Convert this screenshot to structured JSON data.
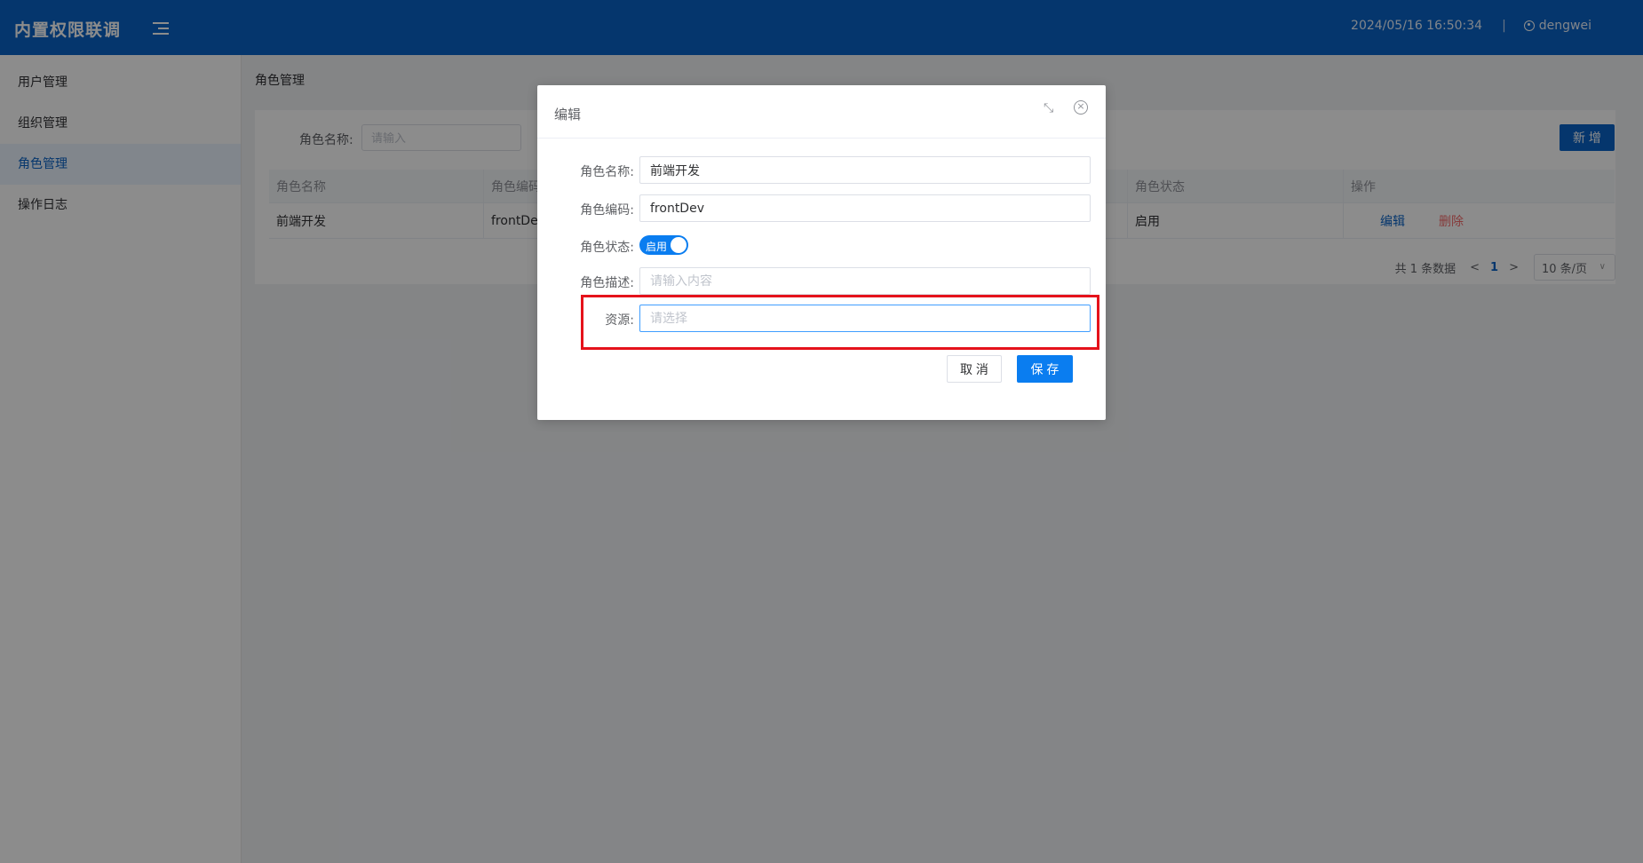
{
  "header": {
    "title": "内置权限联调",
    "datetime": "2024/05/16  16:50:34",
    "separator": "|",
    "username": "dengwei"
  },
  "sidebar": {
    "items": [
      {
        "label": "用户管理"
      },
      {
        "label": "组织管理"
      },
      {
        "label": "角色管理"
      },
      {
        "label": "操作日志"
      }
    ],
    "active_index": 2
  },
  "breadcrumb": "角色管理",
  "search": {
    "label": "角色名称:",
    "placeholder": "请输入"
  },
  "toolbar": {
    "add_label": "新 增"
  },
  "table": {
    "headers": [
      "角色名称",
      "角色编码",
      "",
      "",
      "角色状态",
      "操作"
    ],
    "rows": [
      {
        "name": "前端开发",
        "code": "frontDev",
        "status": "启用",
        "edit": "编辑",
        "delete": "删除"
      }
    ]
  },
  "pager": {
    "total_text": "共 1 条数据",
    "prev": "<",
    "page": "1",
    "next": ">",
    "size_text": "10 条/页",
    "size_chevron": "∨"
  },
  "dialog": {
    "title": "编辑",
    "fullscreen_icon": "⤡",
    "close_icon": "×",
    "fields": {
      "name_label": "角色名称:",
      "name_value": "前端开发",
      "code_label": "角色编码:",
      "code_value": "frontDev",
      "status_label": "角色状态:",
      "status_text": "启用",
      "desc_label": "角色描述:",
      "desc_placeholder": "请输入内容",
      "resource_label": "资源:",
      "resource_placeholder": "请选择"
    },
    "cancel_label": "取 消",
    "save_label": "保 存"
  },
  "colors": {
    "header_bg": "#0a63c6",
    "primary": "#0a7df0",
    "danger": "#f56c6c",
    "highlight_border": "#e5121b"
  }
}
